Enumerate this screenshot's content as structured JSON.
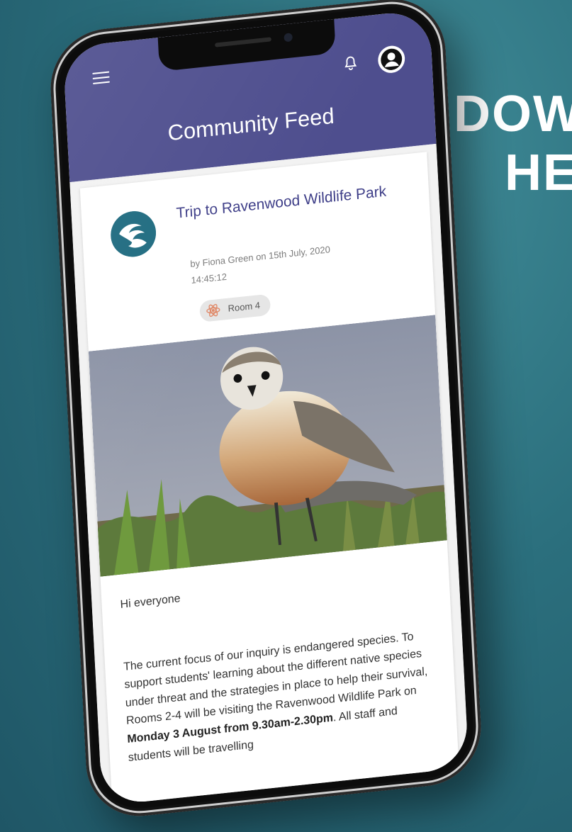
{
  "promo": {
    "line1": "DOW",
    "line2": "HE"
  },
  "app": {
    "title": "Community Feed",
    "icons": {
      "menu": "menu-icon",
      "bell": "bell-icon",
      "avatar": "avatar-icon"
    },
    "header_color": "#4e4e8e"
  },
  "post": {
    "title": "Trip to Ravenwood Wildlife Park",
    "author_line": "by Fiona Green on 15th July, 2020",
    "time": "14:45:12",
    "tag": "Room 4",
    "image_subject": "bird photo",
    "greeting": "Hi everyone",
    "body_before_bold": "The current focus of our inquiry is endangered species. To support students' learning about the different native species under threat and the strategies in place to help their survival, Rooms 2-4 will be visiting the Ravenwood Wildlife Park on ",
    "body_bold": "Monday 3 August from 9.30am-2.30pm",
    "body_after_bold": ". All staff and students will be travelling"
  }
}
